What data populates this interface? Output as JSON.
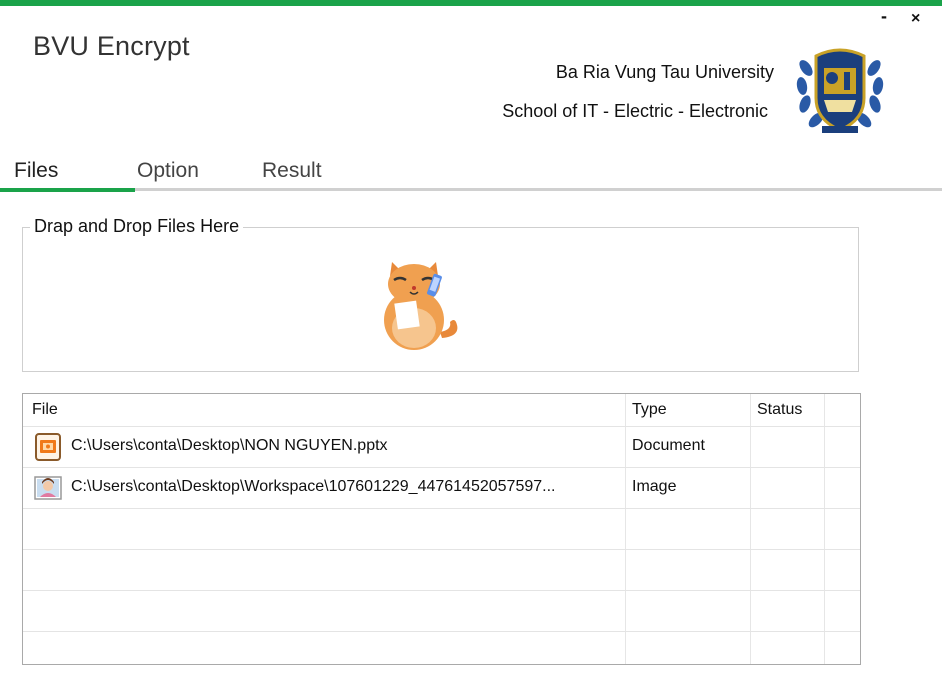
{
  "window": {
    "minimize_label": "-",
    "close_label": "×"
  },
  "app": {
    "title": "BVU Encrypt"
  },
  "header": {
    "university": "Ba Ria Vung Tau University",
    "school": "School of IT - Electric - Electronic"
  },
  "tabs": [
    {
      "label": "Files",
      "active": true
    },
    {
      "label": "Option",
      "active": false
    },
    {
      "label": "Result",
      "active": false
    }
  ],
  "dropzone": {
    "legend": "Drap and Drop Files Here"
  },
  "table": {
    "headers": {
      "file": "File",
      "type": "Type",
      "status": "Status"
    },
    "rows": [
      {
        "file": "C:\\Users\\conta\\Desktop\\NON NGUYEN.pptx",
        "type": "Document",
        "status": "",
        "icon": "powerpoint-file-icon"
      },
      {
        "file": "C:\\Users\\conta\\Desktop\\Workspace\\107601229_44761452057597...",
        "type": "Image",
        "status": "",
        "icon": "image-file-icon"
      }
    ]
  },
  "colors": {
    "accent": "#1aa34a",
    "divider": "#d0d0d0"
  }
}
